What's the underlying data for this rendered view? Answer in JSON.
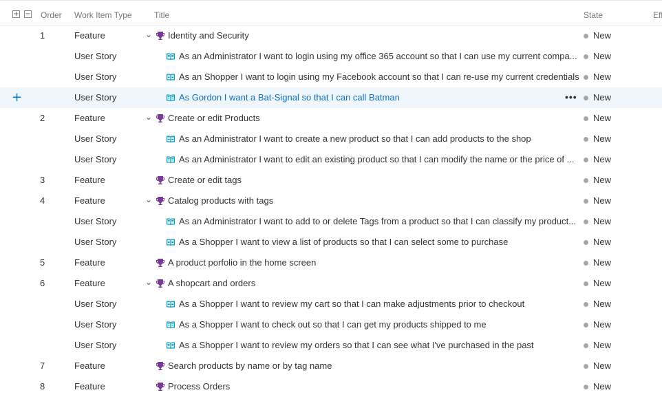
{
  "header": {
    "expand_all": "+",
    "collapse_all": "−",
    "order": "Order",
    "work_item_type": "Work Item Type",
    "title": "Title",
    "state": "State",
    "effort": "Eff"
  },
  "colors": {
    "feature_icon": "#773b93",
    "story_icon": "#009ccc",
    "state_new": "#a6a6a6",
    "selected_row": "#eff6fc",
    "link": "#106ebe"
  },
  "row_actions": {
    "more": "•••",
    "add": "+"
  },
  "rows": [
    {
      "order": "1",
      "type": "Feature",
      "title": "Identity and Security",
      "state": "New",
      "kind": "feature",
      "expanded": true
    },
    {
      "order": "",
      "type": "User Story",
      "title": "As an Administrator I want to login using my office 365 account so that I can use my current compa...",
      "state": "New",
      "kind": "story"
    },
    {
      "order": "",
      "type": "User Story",
      "title": "As an Shopper I want to login using my Facebook account so that I can re-use my current credentials",
      "state": "New",
      "kind": "story"
    },
    {
      "order": "",
      "type": "User Story",
      "title": "As Gordon I want a Bat-Signal so that I can call Batman",
      "state": "New",
      "kind": "story",
      "selected": true
    },
    {
      "order": "2",
      "type": "Feature",
      "title": "Create or edit Products",
      "state": "New",
      "kind": "feature",
      "expanded": true
    },
    {
      "order": "",
      "type": "User Story",
      "title": "As an Administrator I want to create a new product so that I can add products to the shop",
      "state": "New",
      "kind": "story"
    },
    {
      "order": "",
      "type": "User Story",
      "title": "As an Administrator I want to edit an existing product so that I can modify the name or the price of ...",
      "state": "New",
      "kind": "story"
    },
    {
      "order": "3",
      "type": "Feature",
      "title": "Create or edit tags",
      "state": "New",
      "kind": "feature",
      "expanded": false
    },
    {
      "order": "4",
      "type": "Feature",
      "title": "Catalog products with tags",
      "state": "New",
      "kind": "feature",
      "expanded": true
    },
    {
      "order": "",
      "type": "User Story",
      "title": "As an Administrator I want to add to or delete Tags from a product so that I can classify my product...",
      "state": "New",
      "kind": "story"
    },
    {
      "order": "",
      "type": "User Story",
      "title": "As a Shopper I want to view a list of products so that I can select some to purchase",
      "state": "New",
      "kind": "story"
    },
    {
      "order": "5",
      "type": "Feature",
      "title": "A product porfolio in the home screen",
      "state": "New",
      "kind": "feature",
      "expanded": false
    },
    {
      "order": "6",
      "type": "Feature",
      "title": "A shopcart and orders",
      "state": "New",
      "kind": "feature",
      "expanded": true
    },
    {
      "order": "",
      "type": "User Story",
      "title": "As a Shopper I want to review my cart so that I can make adjustments prior to checkout",
      "state": "New",
      "kind": "story"
    },
    {
      "order": "",
      "type": "User Story",
      "title": "As a Shopper I want to check out so that I can get my products shipped to me",
      "state": "New",
      "kind": "story"
    },
    {
      "order": "",
      "type": "User Story",
      "title": "As a Shopper I want to review my orders so that I can see what I've purchased in the past",
      "state": "New",
      "kind": "story"
    },
    {
      "order": "7",
      "type": "Feature",
      "title": "Search products by name or by tag name",
      "state": "New",
      "kind": "feature",
      "expanded": false
    },
    {
      "order": "8",
      "type": "Feature",
      "title": "Process Orders",
      "state": "New",
      "kind": "feature",
      "expanded": false
    }
  ]
}
